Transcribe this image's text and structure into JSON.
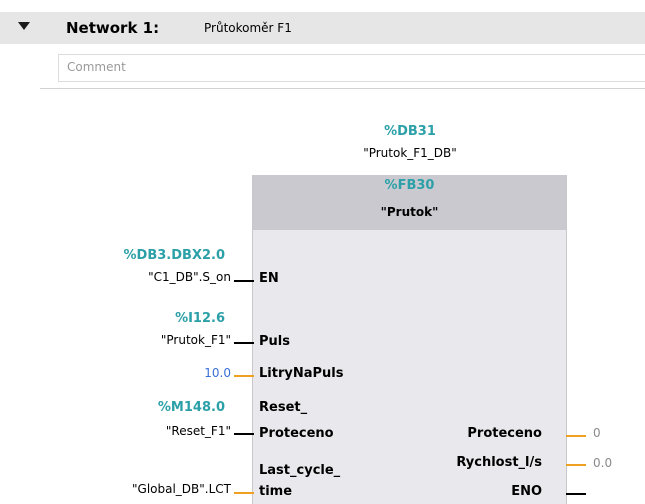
{
  "network": {
    "title": "Network 1:",
    "name": "Průtokoměr F1",
    "comment_placeholder": "Comment"
  },
  "block": {
    "instance_address": "%DB31",
    "instance_name": "\"Prutok_F1_DB\"",
    "fb_address": "%FB30",
    "fb_name": "\"Prutok\""
  },
  "inputs": [
    {
      "pin": "EN",
      "address": "%DB3.DBX2.0",
      "tag": "\"C1_DB\".S_on"
    },
    {
      "pin": "Puls",
      "address": "%I12.6",
      "tag": "\"Prutok_F1\""
    },
    {
      "pin": "LitryNaPuls",
      "constant": "10.0"
    },
    {
      "pin_line1": "Reset_",
      "pin_line2": "Proteceno",
      "address": "%M148.0",
      "tag": "\"Reset_F1\""
    },
    {
      "pin_line1": "Last_cycle_",
      "pin_line2": "time",
      "tag": "\"Global_DB\".LCT"
    }
  ],
  "outputs": [
    {
      "pin": "Proteceno",
      "value": "0"
    },
    {
      "pin": "Rychlost_l/s",
      "value": "0.0"
    },
    {
      "pin": "ENO"
    }
  ],
  "colors": {
    "address": "#2ca0a8",
    "constant": "#3a6fd8",
    "wire_bool": "#000000",
    "wire_value": "#f0a020",
    "header_bg": "#e6e6e6",
    "block_body": "#e8e8ed",
    "block_head": "#c9c9cf"
  }
}
